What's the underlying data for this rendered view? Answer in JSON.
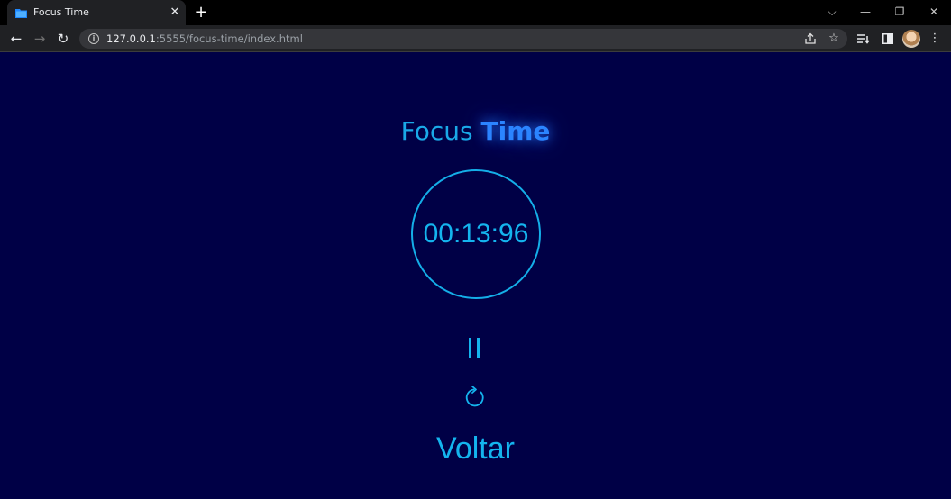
{
  "browser": {
    "tab_title": "Focus Time",
    "tab_close": "✕",
    "new_tab": "+",
    "window_controls": {
      "tab_search": "⌵",
      "minimize": "—",
      "restore": "❐",
      "close": "✕"
    },
    "nav": {
      "back": "←",
      "forward": "→",
      "reload": "↻"
    },
    "url_host": "127.0.0.1",
    "url_path": ":5555/focus-time/index.html",
    "icons": {
      "favicon": "folder-icon",
      "info": "info-icon",
      "share": "share-icon",
      "bookmark": "star-icon",
      "reading_list": "reading-list-icon",
      "side_panel": "side-panel-icon",
      "profile": "avatar",
      "menu": "kebab-menu-icon"
    },
    "colors": {
      "favicon": "#1e88ff"
    }
  },
  "page": {
    "title_part1": "Focus ",
    "title_part2": "Time",
    "timer": "00:13:96",
    "pause_icon": "pause-icon",
    "reset_icon": "reset-icon",
    "back_label": "Voltar",
    "colors": {
      "background": "#000046",
      "accent": "#14b4ee",
      "title_highlight": "#2b84ff"
    }
  }
}
